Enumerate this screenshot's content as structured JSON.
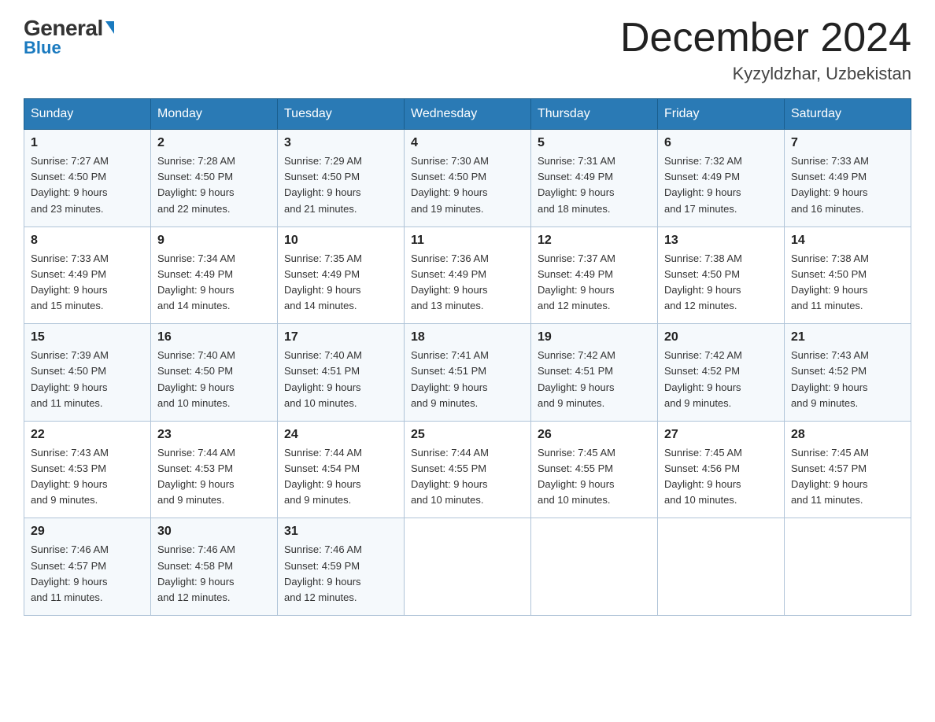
{
  "logo": {
    "general": "General",
    "blue": "Blue",
    "arrow": "▶"
  },
  "title": "December 2024",
  "location": "Kyzyldzhar, Uzbekistan",
  "weekdays": [
    "Sunday",
    "Monday",
    "Tuesday",
    "Wednesday",
    "Thursday",
    "Friday",
    "Saturday"
  ],
  "weeks": [
    [
      {
        "day": "1",
        "sunrise": "7:27 AM",
        "sunset": "4:50 PM",
        "daylight": "9 hours and 23 minutes."
      },
      {
        "day": "2",
        "sunrise": "7:28 AM",
        "sunset": "4:50 PM",
        "daylight": "9 hours and 22 minutes."
      },
      {
        "day": "3",
        "sunrise": "7:29 AM",
        "sunset": "4:50 PM",
        "daylight": "9 hours and 21 minutes."
      },
      {
        "day": "4",
        "sunrise": "7:30 AM",
        "sunset": "4:50 PM",
        "daylight": "9 hours and 19 minutes."
      },
      {
        "day": "5",
        "sunrise": "7:31 AM",
        "sunset": "4:49 PM",
        "daylight": "9 hours and 18 minutes."
      },
      {
        "day": "6",
        "sunrise": "7:32 AM",
        "sunset": "4:49 PM",
        "daylight": "9 hours and 17 minutes."
      },
      {
        "day": "7",
        "sunrise": "7:33 AM",
        "sunset": "4:49 PM",
        "daylight": "9 hours and 16 minutes."
      }
    ],
    [
      {
        "day": "8",
        "sunrise": "7:33 AM",
        "sunset": "4:49 PM",
        "daylight": "9 hours and 15 minutes."
      },
      {
        "day": "9",
        "sunrise": "7:34 AM",
        "sunset": "4:49 PM",
        "daylight": "9 hours and 14 minutes."
      },
      {
        "day": "10",
        "sunrise": "7:35 AM",
        "sunset": "4:49 PM",
        "daylight": "9 hours and 14 minutes."
      },
      {
        "day": "11",
        "sunrise": "7:36 AM",
        "sunset": "4:49 PM",
        "daylight": "9 hours and 13 minutes."
      },
      {
        "day": "12",
        "sunrise": "7:37 AM",
        "sunset": "4:49 PM",
        "daylight": "9 hours and 12 minutes."
      },
      {
        "day": "13",
        "sunrise": "7:38 AM",
        "sunset": "4:50 PM",
        "daylight": "9 hours and 12 minutes."
      },
      {
        "day": "14",
        "sunrise": "7:38 AM",
        "sunset": "4:50 PM",
        "daylight": "9 hours and 11 minutes."
      }
    ],
    [
      {
        "day": "15",
        "sunrise": "7:39 AM",
        "sunset": "4:50 PM",
        "daylight": "9 hours and 11 minutes."
      },
      {
        "day": "16",
        "sunrise": "7:40 AM",
        "sunset": "4:50 PM",
        "daylight": "9 hours and 10 minutes."
      },
      {
        "day": "17",
        "sunrise": "7:40 AM",
        "sunset": "4:51 PM",
        "daylight": "9 hours and 10 minutes."
      },
      {
        "day": "18",
        "sunrise": "7:41 AM",
        "sunset": "4:51 PM",
        "daylight": "9 hours and 9 minutes."
      },
      {
        "day": "19",
        "sunrise": "7:42 AM",
        "sunset": "4:51 PM",
        "daylight": "9 hours and 9 minutes."
      },
      {
        "day": "20",
        "sunrise": "7:42 AM",
        "sunset": "4:52 PM",
        "daylight": "9 hours and 9 minutes."
      },
      {
        "day": "21",
        "sunrise": "7:43 AM",
        "sunset": "4:52 PM",
        "daylight": "9 hours and 9 minutes."
      }
    ],
    [
      {
        "day": "22",
        "sunrise": "7:43 AM",
        "sunset": "4:53 PM",
        "daylight": "9 hours and 9 minutes."
      },
      {
        "day": "23",
        "sunrise": "7:44 AM",
        "sunset": "4:53 PM",
        "daylight": "9 hours and 9 minutes."
      },
      {
        "day": "24",
        "sunrise": "7:44 AM",
        "sunset": "4:54 PM",
        "daylight": "9 hours and 9 minutes."
      },
      {
        "day": "25",
        "sunrise": "7:44 AM",
        "sunset": "4:55 PM",
        "daylight": "9 hours and 10 minutes."
      },
      {
        "day": "26",
        "sunrise": "7:45 AM",
        "sunset": "4:55 PM",
        "daylight": "9 hours and 10 minutes."
      },
      {
        "day": "27",
        "sunrise": "7:45 AM",
        "sunset": "4:56 PM",
        "daylight": "9 hours and 10 minutes."
      },
      {
        "day": "28",
        "sunrise": "7:45 AM",
        "sunset": "4:57 PM",
        "daylight": "9 hours and 11 minutes."
      }
    ],
    [
      {
        "day": "29",
        "sunrise": "7:46 AM",
        "sunset": "4:57 PM",
        "daylight": "9 hours and 11 minutes."
      },
      {
        "day": "30",
        "sunrise": "7:46 AM",
        "sunset": "4:58 PM",
        "daylight": "9 hours and 12 minutes."
      },
      {
        "day": "31",
        "sunrise": "7:46 AM",
        "sunset": "4:59 PM",
        "daylight": "9 hours and 12 minutes."
      },
      null,
      null,
      null,
      null
    ]
  ],
  "labels": {
    "sunrise": "Sunrise:",
    "sunset": "Sunset:",
    "daylight": "Daylight:"
  }
}
